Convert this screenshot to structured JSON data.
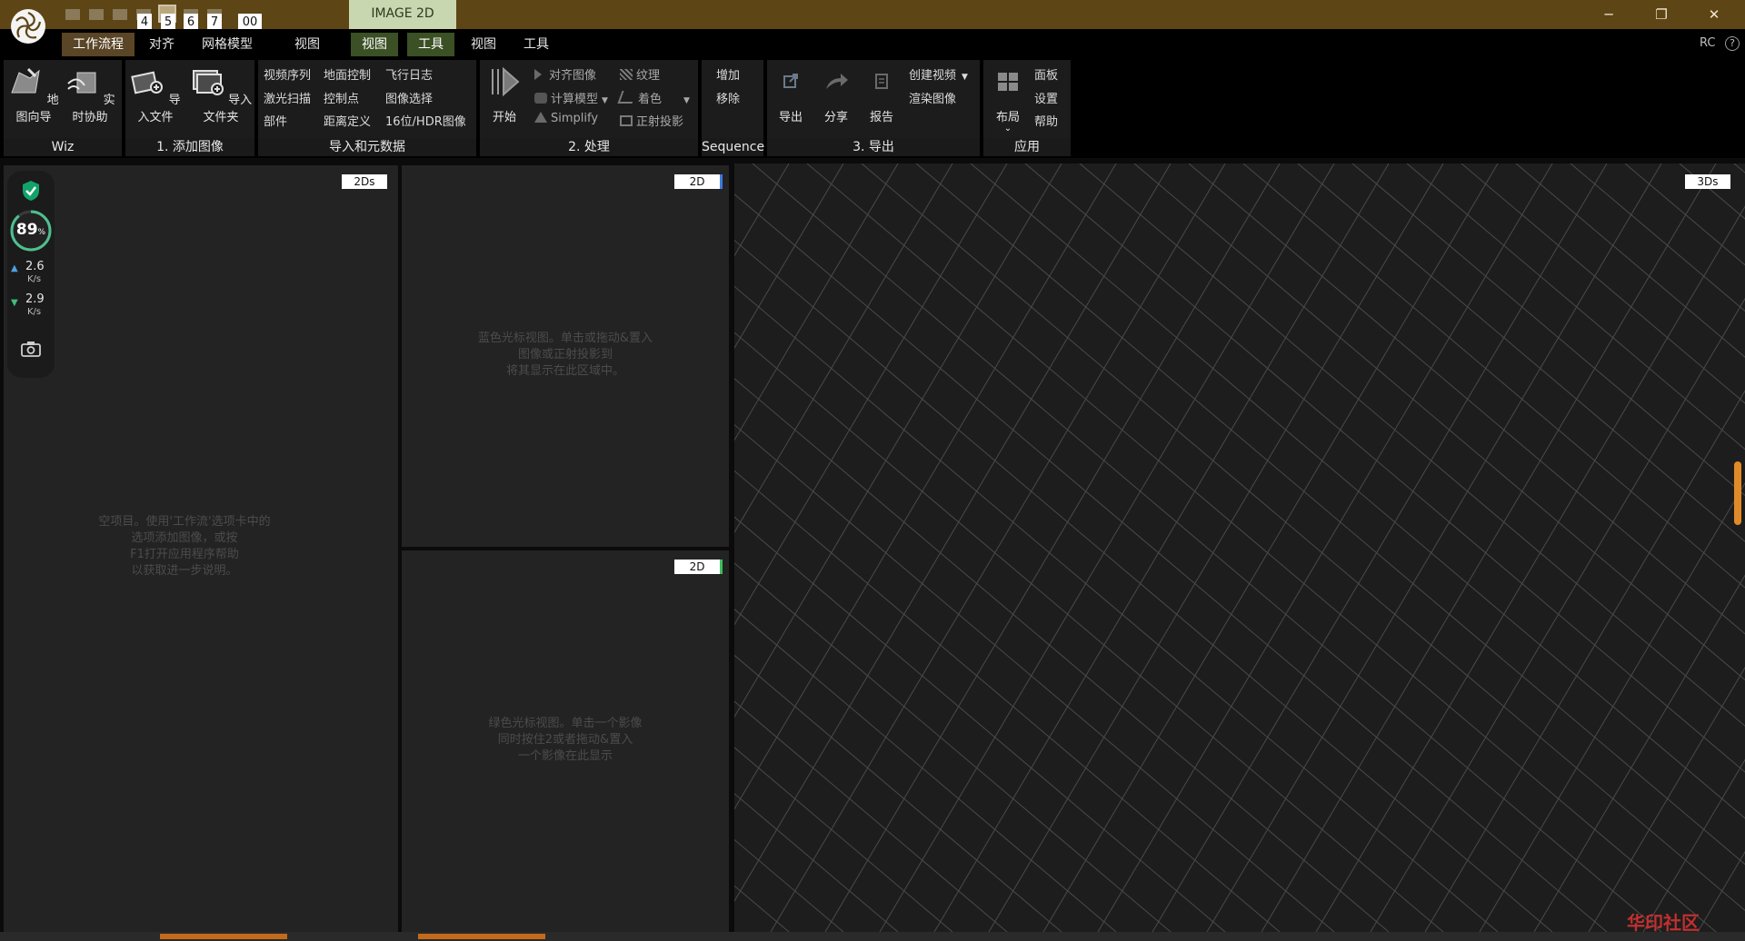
{
  "titlebar": {
    "tab_label": "IMAGE 2D",
    "layout_numbers": [
      "4",
      "5",
      "6",
      "7",
      "00"
    ],
    "window_controls": {
      "minimize": "─",
      "restore": "❐",
      "close": "✕"
    }
  },
  "menu": {
    "items": [
      "工作流程",
      "对齐",
      "网格模型",
      "视图",
      "视图",
      "工具",
      "视图",
      "工具"
    ],
    "right_label": "RC",
    "help_icon": "?"
  },
  "ribbon": {
    "groups": {
      "wiz": {
        "label": "Wiz",
        "buttons": [
          "地图向导",
          "实时协助"
        ]
      },
      "add_images": {
        "label": "1. 添加图像",
        "buttons": [
          "导入文件",
          "导入文件夹"
        ]
      },
      "import_meta": {
        "label": "导入和元数据",
        "items": [
          "视频序列",
          "地面控制",
          "飞行日志",
          "激光扫描",
          "控制点",
          "图像选择",
          "部件",
          "距离定义",
          "16位/HDR图像"
        ]
      },
      "process": {
        "label": "2. 处理",
        "start": "开始",
        "items": [
          "对齐图像",
          "纹理",
          "计算模型",
          "着色",
          "Simplify",
          "正射投影"
        ]
      },
      "sequence": {
        "label": "Sequence",
        "items": [
          "增加",
          "移除"
        ]
      },
      "export": {
        "label": "3. 导出",
        "buttons": [
          "导出",
          "分享",
          "报告"
        ],
        "items": [
          "创建视频",
          "渲染图像"
        ]
      },
      "app": {
        "label": "应用",
        "layout": "布局",
        "items": [
          "面板",
          "设置",
          "帮助"
        ]
      }
    }
  },
  "panels": {
    "left": {
      "tag": "2Ds",
      "hint": [
        "空项目。使用'工作流'选项卡中的",
        "选项添加图像，或按",
        "F1打开应用程序帮助",
        "以获取进一步说明。"
      ]
    },
    "top_middle": {
      "tag": "2D",
      "hint": [
        "蓝色光标视图。单击或拖动&置入",
        "图像或正射投影到",
        "将其显示在此区域中。"
      ]
    },
    "bottom_middle": {
      "tag": "2D",
      "hint": [
        "绿色光标视图。单击一个影像",
        "同时按住2或者拖动&置入",
        "一个影像在此显示"
      ]
    },
    "right": {
      "tag": "3Ds"
    }
  },
  "sidebar": {
    "percent": "89",
    "percent_sign": "%",
    "upload": {
      "value": "2.6",
      "unit": "K/s"
    },
    "download": {
      "value": "2.9",
      "unit": "K/s"
    }
  },
  "watermark": "华印社区"
}
